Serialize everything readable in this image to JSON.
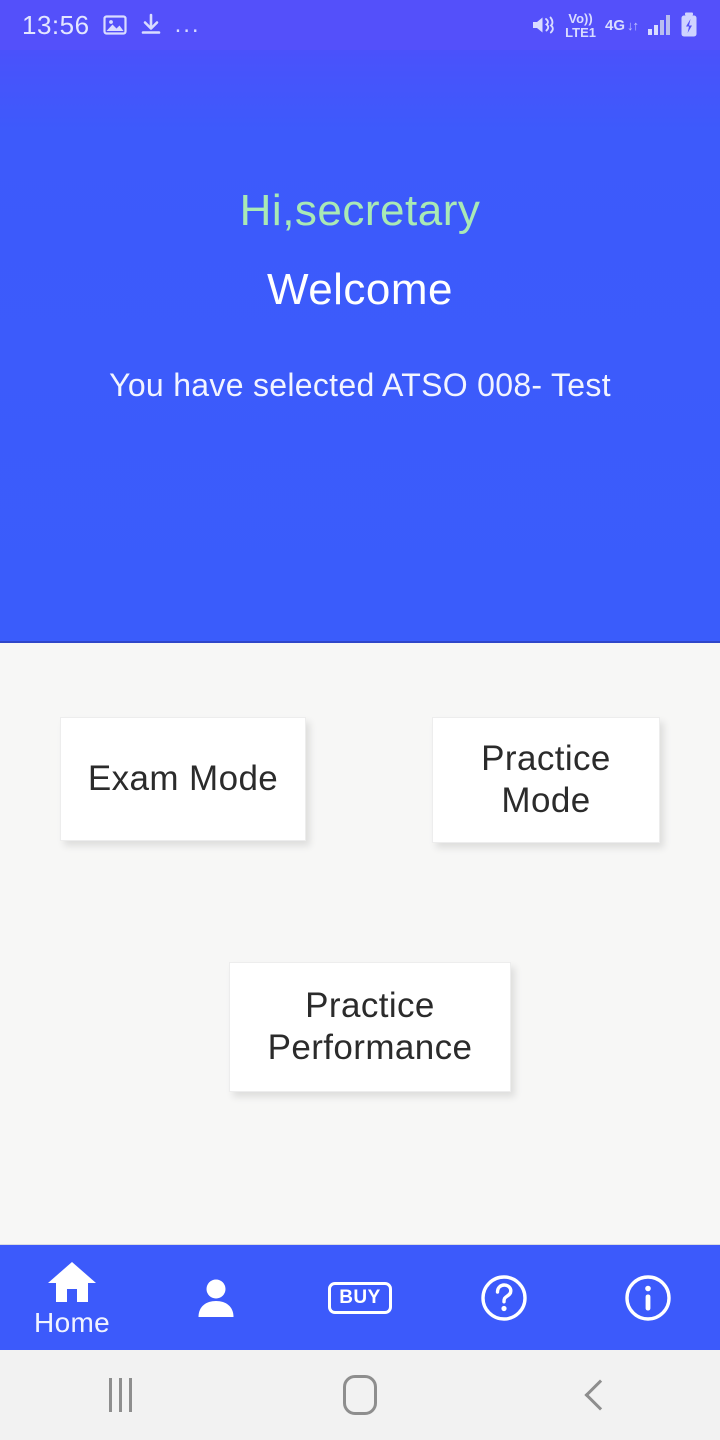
{
  "statusbar": {
    "time": "13:56",
    "icons_left": [
      "image-icon",
      "download-icon",
      "overflow-dots-icon"
    ],
    "overflow": "...",
    "volte_top": "Vo))",
    "volte_bottom": "LTE1",
    "network": "4G",
    "data_arrows": "↓↑",
    "icons_right": [
      "mute-icon",
      "volte-icon",
      "network-4g-icon",
      "signal-bars-icon",
      "battery-charging-icon"
    ],
    "bar_color": "#5450fa"
  },
  "hero": {
    "greeting": "Hi,secretary",
    "welcome": "Welcome",
    "selected_text": "You have selected ATSO 008- Test",
    "greeting_color": "#a9e9b5",
    "background_color": "#3c5afb"
  },
  "main": {
    "cards": [
      {
        "label": "Exam Mode",
        "name": "exam-mode-card"
      },
      {
        "label": "Practice Mode",
        "name": "practice-mode-card"
      },
      {
        "label": "Practice Performance",
        "name": "practice-performance-card"
      }
    ],
    "background_color": "#f7f7f6"
  },
  "bottomnav": {
    "background_color": "#3c5afb",
    "items": [
      {
        "label": "Home",
        "icon": "home-icon",
        "active": true
      },
      {
        "label": "",
        "icon": "person-icon",
        "active": false
      },
      {
        "label": "BUY",
        "icon": "buy-badge-icon",
        "active": false
      },
      {
        "label": "",
        "icon": "help-question-circle-icon",
        "active": false
      },
      {
        "label": "",
        "icon": "info-circle-icon",
        "active": false
      }
    ]
  },
  "androidnav": {
    "items": [
      "recents-icon",
      "home-icon",
      "back-icon"
    ],
    "background_color": "#f2f2f2"
  }
}
